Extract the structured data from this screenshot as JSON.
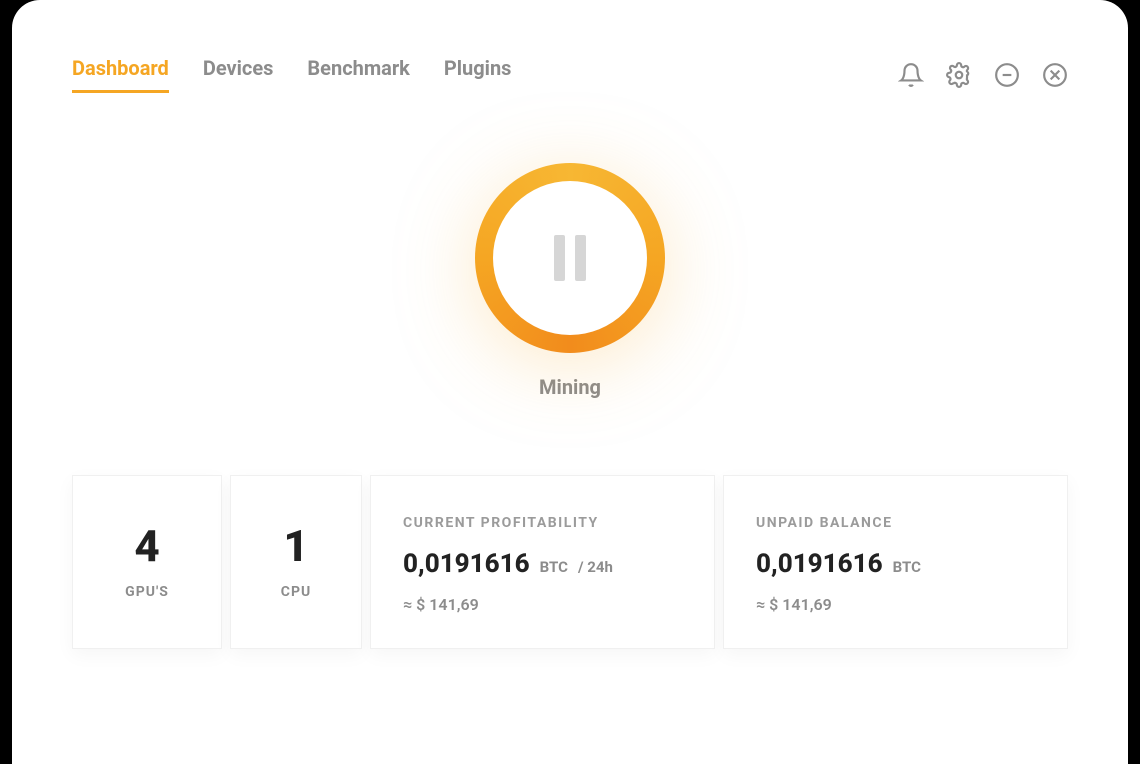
{
  "nav": {
    "tabs": [
      "Dashboard",
      "Devices",
      "Benchmark",
      "Plugins"
    ],
    "activeIndex": 0
  },
  "mining": {
    "statusLabel": "Mining"
  },
  "stats": {
    "gpus": {
      "value": "4",
      "label": "GPU'S"
    },
    "cpu": {
      "value": "1",
      "label": "CPU"
    },
    "profitability": {
      "title": "CURRENT PROFITABILITY",
      "value": "0,0191616",
      "unit": "BTC",
      "per": "/ 24h",
      "approx": "≈ $ 141,69"
    },
    "balance": {
      "title": "UNPAID BALANCE",
      "value": "0,0191616",
      "unit": "BTC",
      "approx": "≈ $ 141,69"
    }
  },
  "colors": {
    "accent": "#f5a623"
  }
}
